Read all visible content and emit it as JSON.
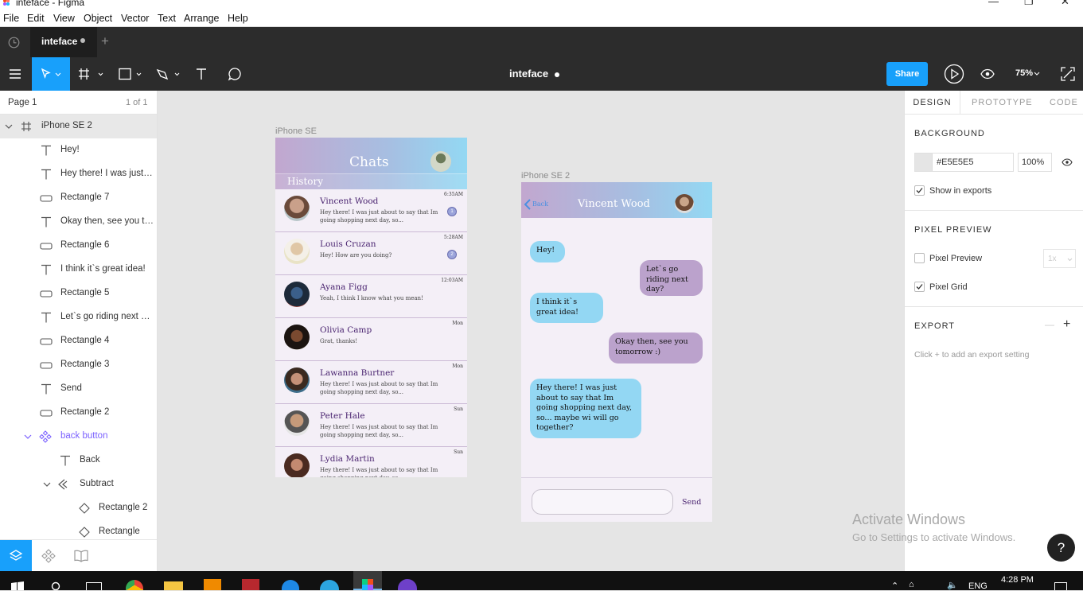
{
  "window": {
    "title": "inteface - Figma"
  },
  "menu": [
    "File",
    "Edit",
    "View",
    "Object",
    "Vector",
    "Text",
    "Arrange",
    "Help"
  ],
  "tab": {
    "name": "inteface",
    "add": "+"
  },
  "toolbar": {
    "doc_title": "inteface",
    "share_label": "Share",
    "zoom": "75%"
  },
  "pages": {
    "label": "Page 1",
    "count": "1 of 1"
  },
  "layers": {
    "frame": "iPhone SE 2",
    "items": [
      {
        "type": "text",
        "label": "Hey!"
      },
      {
        "type": "text",
        "label": "Hey there! I was just a..."
      },
      {
        "type": "rect",
        "label": "Rectangle 7"
      },
      {
        "type": "text",
        "label": "Okay then, see you tom..."
      },
      {
        "type": "rect",
        "label": "Rectangle 6"
      },
      {
        "type": "text",
        "label": "I think it`s great idea!"
      },
      {
        "type": "rect",
        "label": "Rectangle 5"
      },
      {
        "type": "text",
        "label": "Let`s go riding next da..."
      },
      {
        "type": "rect",
        "label": "Rectangle 4"
      },
      {
        "type": "rect",
        "label": "Rectangle 3"
      },
      {
        "type": "text",
        "label": "Send"
      },
      {
        "type": "rect",
        "label": "Rectangle 2"
      }
    ],
    "component": "back button",
    "component_children": {
      "text": "Back",
      "group": "Subtract",
      "rect_a": "Rectangle 2",
      "rect_b": "Rectangle"
    }
  },
  "design_panel": {
    "tabs": [
      "DESIGN",
      "PROTOTYPE",
      "CODE"
    ],
    "background_title": "BACKGROUND",
    "bg_hex": "#E5E5E5",
    "bg_opacity": "100%",
    "show_in_exports": "Show in exports",
    "pixel_preview_title": "PIXEL PREVIEW",
    "pixel_preview": "Pixel Preview",
    "pixel_preview_scale": "1x",
    "pixel_grid": "Pixel Grid",
    "export_title": "EXPORT",
    "export_minus": "—",
    "export_plus": "+",
    "export_hint": "Click + to add an export setting"
  },
  "canvas": {
    "frame1_label": "iPhone SE",
    "frame2_label": "iPhone SE 2",
    "chats": {
      "title": "Chats",
      "history": "History",
      "rows": [
        {
          "name": "Vincent Wood",
          "msg": "Hey there! I was just about to say that Im going shopping next day, so...",
          "time": "6:35AM",
          "badge": "1"
        },
        {
          "name": "Louis Cruzan",
          "msg": "Hey! How are you doing?",
          "time": "5:28AM",
          "badge": "2"
        },
        {
          "name": "Ayana Figg",
          "msg": "Yeah, I think I know what you mean!",
          "time": "12:03AM",
          "badge": ""
        },
        {
          "name": "Olivia Camp",
          "msg": "Grat, thanks!",
          "time": "Mon",
          "badge": ""
        },
        {
          "name": "Lawanna Burtner",
          "msg": "Hey there! I was just about to say that Im going shopping next day, so...",
          "time": "Mon",
          "badge": ""
        },
        {
          "name": "Peter Hale",
          "msg": "Hey there! I was just about to say that Im going shopping next day, so...",
          "time": "Sun",
          "badge": ""
        },
        {
          "name": "Lydia Martin",
          "msg": "Hey there! I was just about to say that Im going shopping next day, so...",
          "time": "Sun",
          "badge": ""
        }
      ]
    },
    "conversation": {
      "back": "Back",
      "contact": "Vincent Wood",
      "messages": [
        "Hey!",
        "Let`s go riding next day?",
        "I think it`s great idea!",
        "Okay then, see you tomorrow :)",
        "Hey there! I was just about to say that Im going shopping next day, so... maybe wi will go together?"
      ],
      "send": "Send"
    }
  },
  "watermark": {
    "title": "Activate Windows",
    "sub": "Go to Settings to activate Windows."
  },
  "help": "?",
  "taskbar": {
    "time": "4:28 PM",
    "lang": "ENG"
  },
  "colors": {
    "accent": "#18a0fb",
    "dark": "#2c2c2c",
    "bubble_blue": "#93d7f3",
    "bubble_purple": "#bba2cc",
    "chat_name": "#4a2470"
  }
}
